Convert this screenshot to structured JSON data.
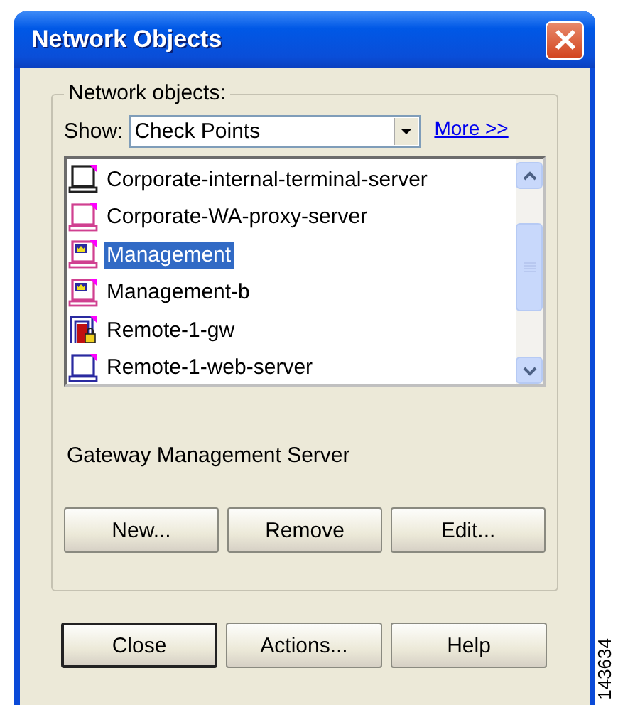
{
  "window": {
    "title": "Network Objects"
  },
  "group": {
    "label": "Network objects:"
  },
  "show": {
    "label": "Show:",
    "value": "Check Points"
  },
  "more_link": "More >>",
  "objects": [
    {
      "name": "Corporate-internal-terminal-server",
      "kind": "host",
      "color": "#202020",
      "selected": false
    },
    {
      "name": "Corporate-WA-proxy-server",
      "kind": "host",
      "color": "#d04090",
      "selected": false
    },
    {
      "name": "Management",
      "kind": "management",
      "color": "#d04090",
      "selected": true
    },
    {
      "name": "Management-b",
      "kind": "management",
      "color": "#d04090",
      "selected": false
    },
    {
      "name": "Remote-1-gw",
      "kind": "gateway",
      "color": "#2a2aa0",
      "selected": false
    },
    {
      "name": "Remote-1-web-server",
      "kind": "host",
      "color": "#2a2aa0",
      "selected": false
    }
  ],
  "description": "Gateway Management Server",
  "object_buttons": [
    "New...",
    "Remove",
    "Edit..."
  ],
  "dialog_buttons": [
    {
      "label": "Close",
      "default": true
    },
    {
      "label": "Actions...",
      "default": false
    },
    {
      "label": "Help",
      "default": false
    }
  ],
  "figure_number": "143634"
}
